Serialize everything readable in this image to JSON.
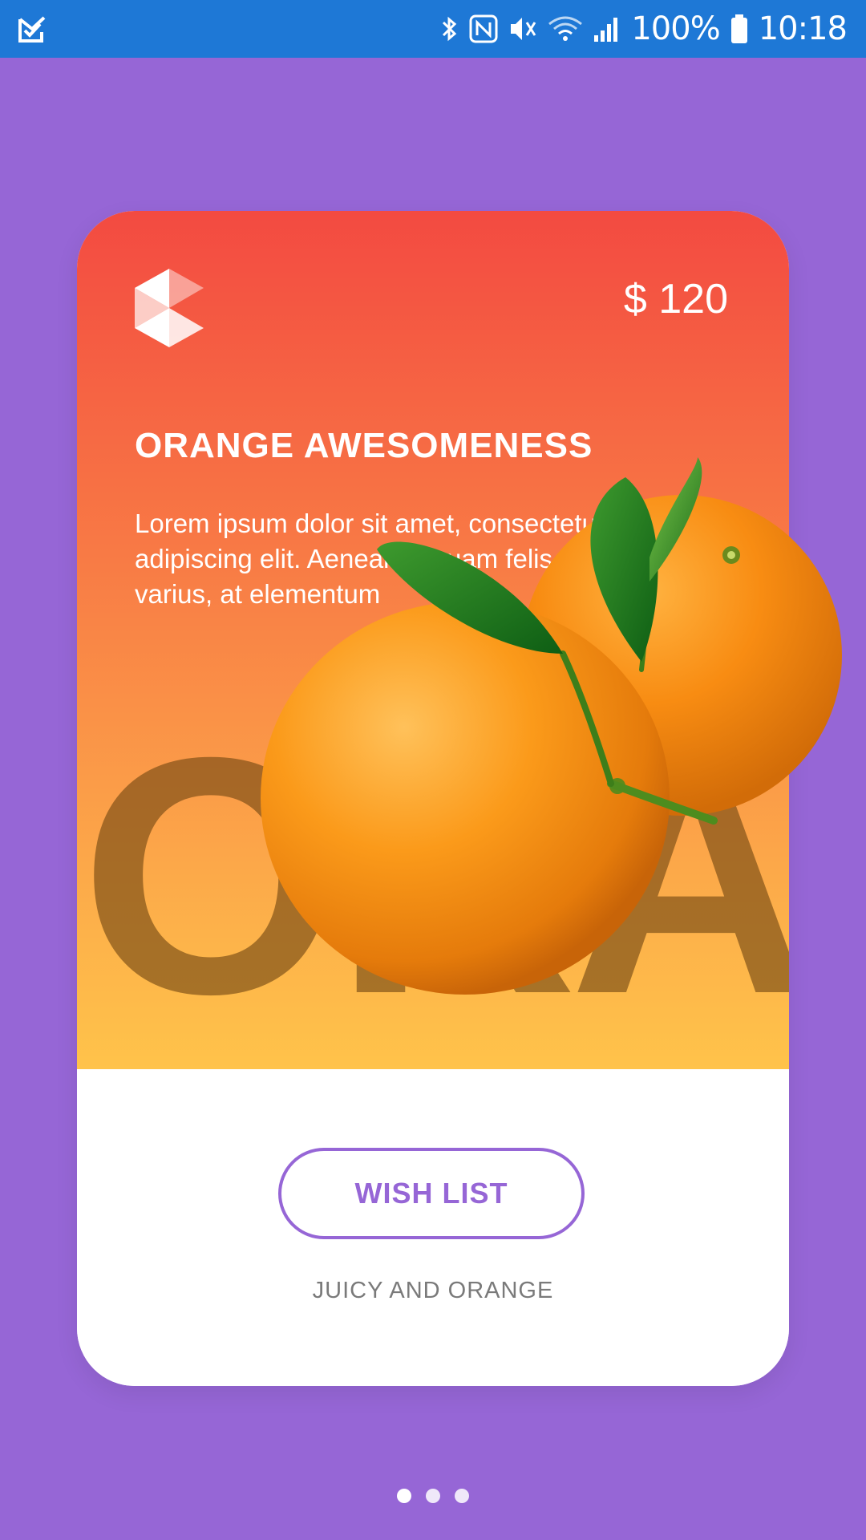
{
  "status_bar": {
    "battery": "100%",
    "time": "10:18",
    "icons": [
      "app-check-icon",
      "bluetooth-icon",
      "nfc-icon",
      "vibrate-mute-icon",
      "wifi-icon",
      "signal-icon",
      "battery-icon"
    ]
  },
  "card": {
    "price": "$ 120",
    "title": "ORANGE AWESOMENESS",
    "description": "Lorem ipsum dolor sit amet, consectetur adipiscing elit. Aenean aliquam felis varius, at elementum",
    "watermark": "ORA",
    "wishlist_label": "WISH LIST",
    "subtitle": "JUICY AND ORANGE"
  },
  "pager": {
    "count": 3,
    "active_index": 0
  },
  "colors": {
    "background": "#9666D6",
    "status_bar": "#1E78D6",
    "gradient_top": "#F34A41",
    "gradient_bottom": "#FFC34A",
    "accent": "#9666D6"
  }
}
